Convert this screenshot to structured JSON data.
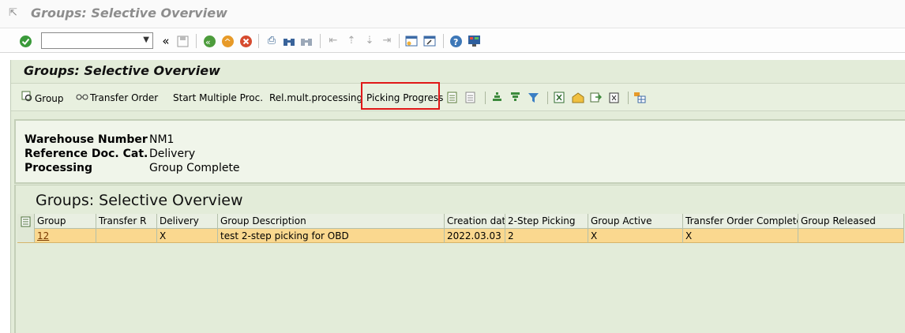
{
  "window": {
    "title": "Groups: Selective Overview"
  },
  "toolbar": {
    "command_field_value": "",
    "collapse_glyph": "«"
  },
  "screen": {
    "title": "Groups: Selective Overview",
    "buttons": {
      "group": "Group",
      "transfer_order": "Transfer Order",
      "start_multiple": "Start Multiple Proc.",
      "rel_mult": "Rel.mult.processing",
      "picking_progress": "Picking Progress"
    }
  },
  "header": {
    "warehouse_label": "Warehouse Number",
    "warehouse_value": "NM1",
    "refdoc_label": "Reference Doc. Cat.",
    "refdoc_value": "Delivery",
    "processing_label": "Processing",
    "processing_value": "Group Complete"
  },
  "list": {
    "title": "Groups: Selective Overview",
    "columns": [
      "Group",
      "Transfer R",
      "Delivery",
      "Group Description",
      "Creation date",
      "2-Step Picking",
      "Group Active",
      "Transfer Order Complete",
      "Group Released"
    ],
    "rows": [
      {
        "group": "12",
        "transfer_r": "",
        "delivery": "X",
        "description": "test 2-step picking for OBD",
        "creation_date": "2022.03.03",
        "two_step": "2",
        "active": "X",
        "to_complete": "X",
        "released": ""
      }
    ]
  },
  "colors": {
    "highlight": "#e01818",
    "row_selected": "#fad88f",
    "background": "#e3ecd9"
  }
}
